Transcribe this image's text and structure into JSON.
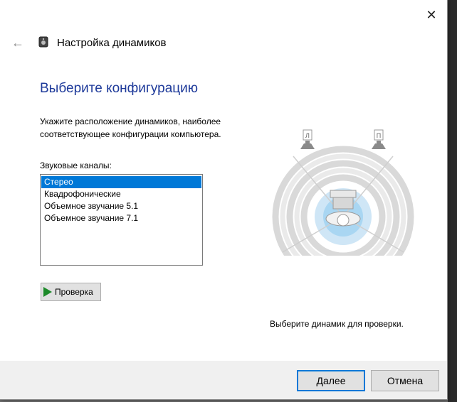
{
  "window": {
    "title": "Настройка динамиков",
    "back_icon": "back-arrow-icon",
    "close_icon": "close-icon"
  },
  "heading": "Выберите конфигурацию",
  "instruction": "Укажите расположение динамиков, наиболее соответствующее конфигурации компьютера.",
  "channels": {
    "label": "Звуковые каналы:",
    "items": [
      "Стерео",
      "Квадрофонические",
      "Объемное звучание 5.1",
      "Объемное звучание 7.1"
    ],
    "selected": "Стерео"
  },
  "test_button": "Проверка",
  "speakers": {
    "left_label": "Л",
    "right_label": "П"
  },
  "select_speaker_hint": "Выберите динамик для проверки.",
  "footer": {
    "next_label": "Далее",
    "cancel_label": "Отмена"
  },
  "colors": {
    "heading": "#1e3a9a",
    "selection": "#0078d7",
    "play": "#1d8a2a"
  }
}
